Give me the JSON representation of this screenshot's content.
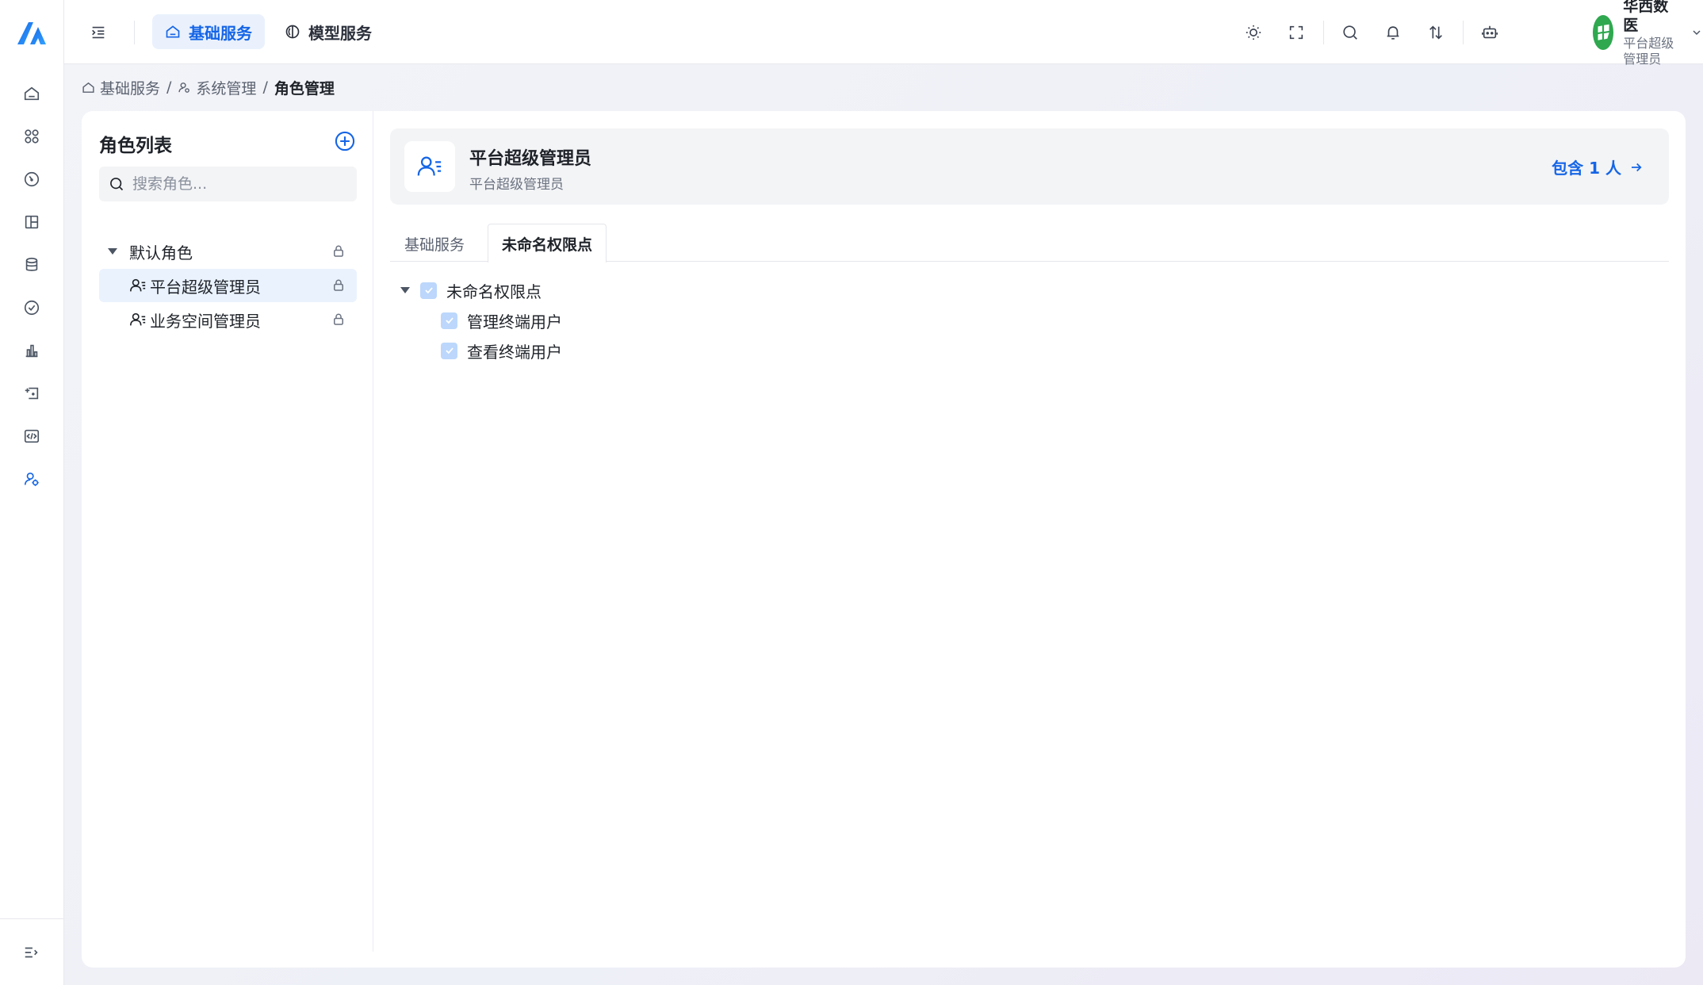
{
  "topbar": {
    "tabs": [
      {
        "label": "基础服务",
        "icon": "home-icon",
        "active": true
      },
      {
        "label": "模型服务",
        "icon": "brain-icon",
        "active": false
      }
    ],
    "user": {
      "name": "华西数医",
      "role": "平台超级管理员"
    }
  },
  "breadcrumb": {
    "items": [
      "基础服务",
      "系统管理"
    ],
    "current": "角色管理",
    "separator": "/"
  },
  "role_list": {
    "title": "角色列表",
    "search_placeholder": "搜索角色...",
    "group": {
      "label": "默认角色"
    },
    "roles": [
      {
        "label": "平台超级管理员",
        "selected": true
      },
      {
        "label": "业务空间管理员",
        "selected": false
      }
    ]
  },
  "role_detail": {
    "name": "平台超级管理员",
    "description": "平台超级管理员",
    "member_link": "包含 1 人",
    "tabs": [
      {
        "label": "基础服务",
        "active": false
      },
      {
        "label": "未命名权限点",
        "active": true
      }
    ],
    "permissions": {
      "root": {
        "label": "未命名权限点",
        "checked": true
      },
      "children": [
        {
          "label": "管理终端用户",
          "checked": true
        },
        {
          "label": "查看终端用户",
          "checked": true
        }
      ]
    }
  },
  "colors": {
    "accent": "#1565e6",
    "selected_bg": "#eaf2fd",
    "checkbox": "#bcd7fb",
    "avatar": "#2fa84f"
  }
}
